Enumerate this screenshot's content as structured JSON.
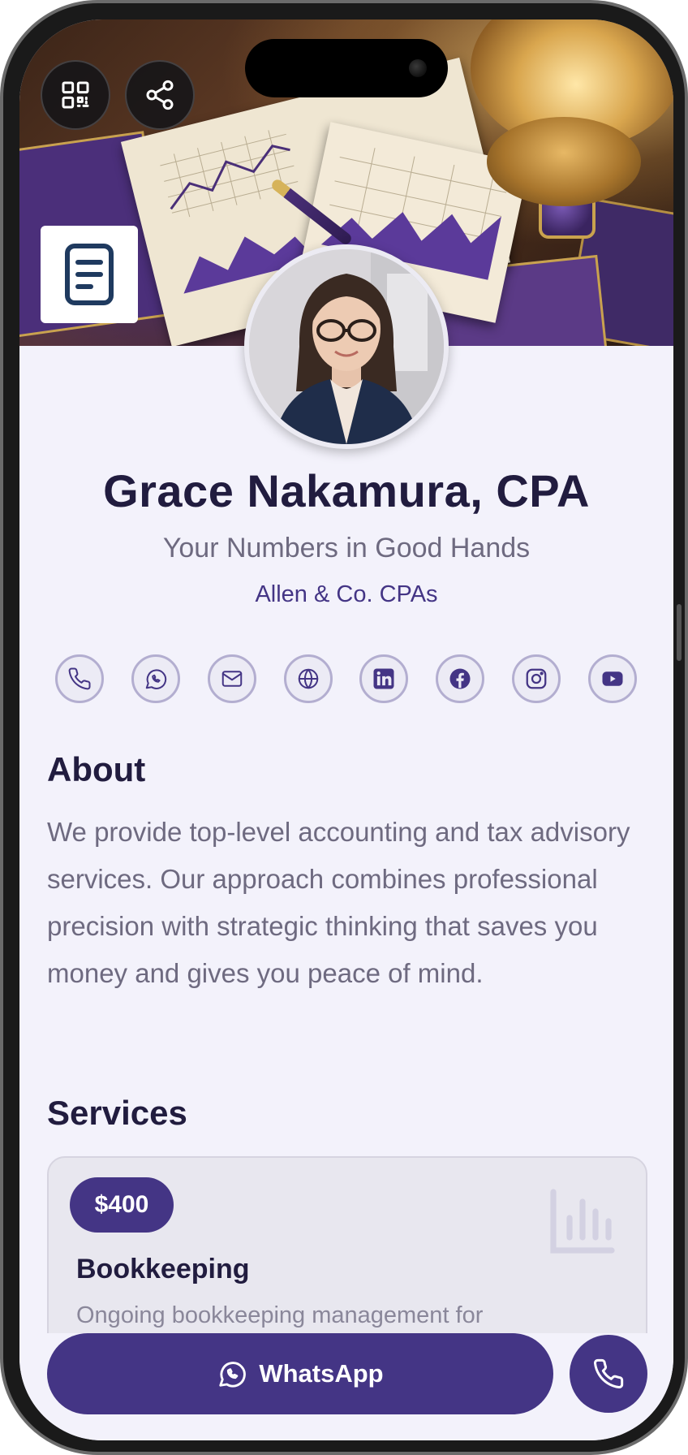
{
  "profile": {
    "name": "Grace Nakamura, CPA",
    "tagline": "Your Numbers in Good Hands",
    "company": "Allen & Co. CPAs"
  },
  "header": {
    "qr_icon": "qr-code-icon",
    "share_icon": "share-icon",
    "logo_icon": "document-icon"
  },
  "socials": [
    {
      "name": "phone-icon"
    },
    {
      "name": "whatsapp-icon"
    },
    {
      "name": "mail-icon"
    },
    {
      "name": "globe-icon"
    },
    {
      "name": "linkedin-icon"
    },
    {
      "name": "facebook-icon"
    },
    {
      "name": "instagram-icon"
    },
    {
      "name": "youtube-icon"
    }
  ],
  "about": {
    "heading": "About",
    "text": "We provide top-level accounting and tax advisory services. Our approach combines professional precision with strategic thinking that saves you money and gives you peace of mind."
  },
  "services": {
    "heading": "Services",
    "items": [
      {
        "price": "$400",
        "title": "Bookkeeping",
        "description": "Ongoing bookkeeping management for",
        "icon": "bar-chart-icon"
      }
    ]
  },
  "actions": {
    "whatsapp_label": "WhatsApp",
    "call_icon": "phone-icon"
  },
  "colors": {
    "accent": "#443585",
    "heading": "#211c3f",
    "muted": "#6e6a80",
    "background": "#f3f2fb"
  }
}
